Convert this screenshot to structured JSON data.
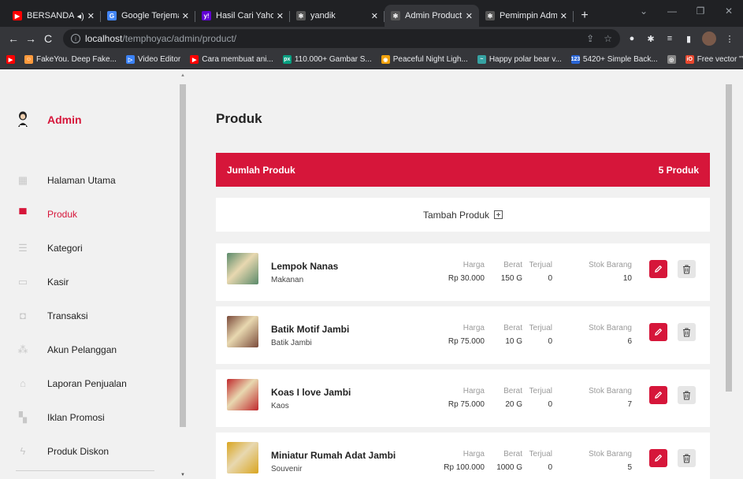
{
  "browser": {
    "tabs": [
      {
        "title": "BERSANDARLA",
        "icon": "youtube-icon",
        "color": "#ff0000",
        "glyph": "▶",
        "audio": true
      },
      {
        "title": "Google Terjemahan",
        "icon": "google-translate-icon",
        "color": "#4285f4",
        "glyph": "G"
      },
      {
        "title": "Hasil Cari Yahoo ur",
        "icon": "yahoo-icon",
        "color": "#6001d2",
        "glyph": "y!"
      },
      {
        "title": "yandik",
        "icon": "site-icon",
        "color": "#555555",
        "glyph": "✻"
      },
      {
        "title": "Admin Product",
        "icon": "site-icon",
        "color": "#555555",
        "glyph": "✻",
        "active": true
      },
      {
        "title": "Pemimpin Admin A",
        "icon": "site-icon",
        "color": "#555555",
        "glyph": "✻"
      }
    ],
    "url_host": "localhost",
    "url_path": "/temphoyac/admin/product/",
    "bookmarks": [
      {
        "label": "",
        "color": "#ff0000",
        "glyph": "▶"
      },
      {
        "label": "FakeYou. Deep Fake...",
        "color": "#ff9a3c",
        "glyph": "☺"
      },
      {
        "label": "Video Editor",
        "color": "#3b82f6",
        "glyph": "▷"
      },
      {
        "label": "Cara membuat ani...",
        "color": "#ff0000",
        "glyph": "▶"
      },
      {
        "label": "110.000+ Gambar S...",
        "color": "#05a081",
        "glyph": "px"
      },
      {
        "label": "Peaceful Night Ligh...",
        "color": "#f2a20c",
        "glyph": "◉"
      },
      {
        "label": "Happy polar bear v...",
        "color": "#36a3a3",
        "glyph": "~"
      },
      {
        "label": "5420+ Simple Back...",
        "color": "#2965d6",
        "glyph": "123"
      },
      {
        "label": "",
        "color": "#888888",
        "glyph": "◎"
      },
      {
        "label": "Free vector \"Vector...",
        "color": "#e8472e",
        "glyph": "iO"
      }
    ]
  },
  "sidebar": {
    "brand": "Admin",
    "items": [
      {
        "label": "Halaman Utama",
        "icon": "home-grid-icon",
        "glyph": "▦"
      },
      {
        "label": "Produk",
        "icon": "product-box-icon",
        "glyph": "▀",
        "active": true
      },
      {
        "label": "Kategori",
        "icon": "category-list-icon",
        "glyph": "☰"
      },
      {
        "label": "Kasir",
        "icon": "monitor-icon",
        "glyph": "▭"
      },
      {
        "label": "Transaksi",
        "icon": "shopping-bag-icon",
        "glyph": "◘"
      },
      {
        "label": "Akun Pelanggan",
        "icon": "users-icon",
        "glyph": "⁂"
      },
      {
        "label": "Laporan Penjualan",
        "icon": "bank-icon",
        "glyph": "⌂"
      },
      {
        "label": "Iklan Promosi",
        "icon": "promo-icon",
        "glyph": "▚"
      },
      {
        "label": "Produk Diskon",
        "icon": "lightning-icon",
        "glyph": "ϟ"
      }
    ]
  },
  "main": {
    "title": "Produk",
    "count_label": "Jumlah Produk",
    "count_value": "5 Produk",
    "add_label": "Tambah Produk",
    "stat_labels": {
      "harga": "Harga",
      "berat": "Berat",
      "terjual": "Terjual",
      "stok": "Stok Barang"
    },
    "products": [
      {
        "name": "Lempok Nanas",
        "category": "Makanan",
        "harga": "Rp 30.000",
        "berat": "150 G",
        "terjual": "0",
        "stok": "10",
        "thumb_color": "#5a8a6a"
      },
      {
        "name": "Batik Motif Jambi",
        "category": "Batik Jambi",
        "harga": "Rp 75.000",
        "berat": "10 G",
        "terjual": "0",
        "stok": "6",
        "thumb_color": "#7a4a3a"
      },
      {
        "name": "Koas I love Jambi",
        "category": "Kaos",
        "harga": "Rp 75.000",
        "berat": "20 G",
        "terjual": "0",
        "stok": "7",
        "thumb_color": "#c0282c"
      },
      {
        "name": "Miniatur Rumah Adat Jambi",
        "category": "Souvenir",
        "harga": "Rp 100.000",
        "berat": "1000 G",
        "terjual": "0",
        "stok": "5",
        "thumb_color": "#d9a520"
      }
    ]
  },
  "colors": {
    "accent": "#d6163a"
  }
}
